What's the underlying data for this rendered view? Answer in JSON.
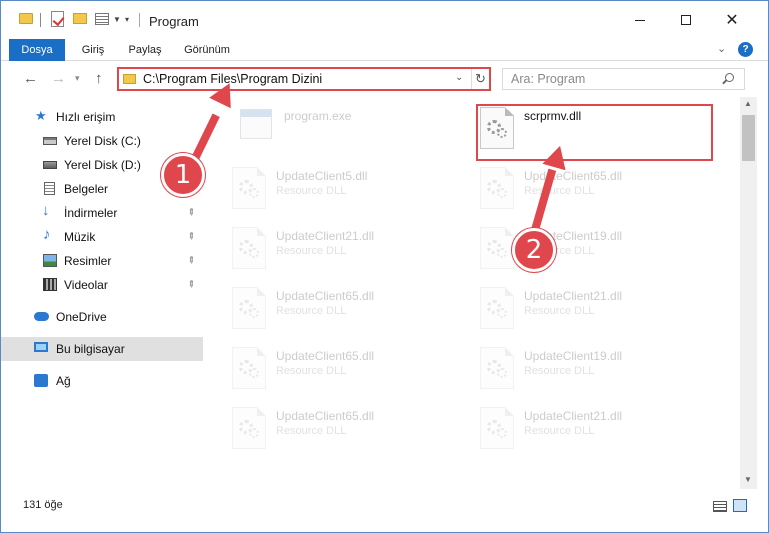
{
  "window": {
    "title": "Program",
    "quick_access_dropdown": "▾"
  },
  "ribbon": {
    "tabs": [
      "Dosya",
      "Giriş",
      "Paylaş",
      "Görünüm"
    ],
    "help": "?"
  },
  "nav": {
    "address": "C:\\Program Files\\Program Dizini",
    "search_placeholder": "Ara: Program"
  },
  "sidebar": {
    "items": [
      {
        "label": "Hızlı erişim",
        "icon": "star-icon"
      },
      {
        "label": "Yerel Disk (C:)",
        "icon": "disk-icon"
      },
      {
        "label": "Yerel Disk (D:)",
        "icon": "disk-icon"
      },
      {
        "label": "Belgeler",
        "icon": "documents-icon"
      },
      {
        "label": "İndirmeler",
        "icon": "download-icon",
        "pinned": true
      },
      {
        "label": "Müzik",
        "icon": "music-icon",
        "pinned": true
      },
      {
        "label": "Resimler",
        "icon": "pictures-icon",
        "pinned": true
      },
      {
        "label": "Videolar",
        "icon": "videos-icon",
        "pinned": true
      },
      {
        "label": "OneDrive",
        "icon": "cloud-icon"
      },
      {
        "label": "Bu bilgisayar",
        "icon": "computer-icon",
        "selected": true
      },
      {
        "label": "Ağ",
        "icon": "network-icon"
      }
    ]
  },
  "files": [
    {
      "name": "program.exe",
      "type": "",
      "highlighted": false
    },
    {
      "name": "scrprmv.dll",
      "type": "",
      "highlighted": true
    },
    {
      "name": "UpdateClient5.dll",
      "type": "Resource DLL"
    },
    {
      "name": "UpdateClient65.dll",
      "type": "Resource DLL"
    },
    {
      "name": "UpdateClient21.dll",
      "type": "Resource DLL"
    },
    {
      "name": "UpdateClient19.dll",
      "type": "Resource DLL"
    },
    {
      "name": "UpdateClient65.dll",
      "type": "Resource DLL"
    },
    {
      "name": "UpdateClient21.dll",
      "type": "Resource DLL"
    },
    {
      "name": "UpdateClient65.dll",
      "type": "Resource DLL"
    },
    {
      "name": "UpdateClient19.dll",
      "type": "Resource DLL"
    },
    {
      "name": "UpdateClient65.dll",
      "type": "Resource DLL"
    },
    {
      "name": "UpdateClient21.dll",
      "type": "Resource DLL"
    }
  ],
  "status": {
    "item_count": "131 öğe"
  },
  "callouts": [
    {
      "number": "1"
    },
    {
      "number": "2"
    }
  ],
  "colors": {
    "accent": "#1a6ec6",
    "highlight": "#e0474c"
  }
}
